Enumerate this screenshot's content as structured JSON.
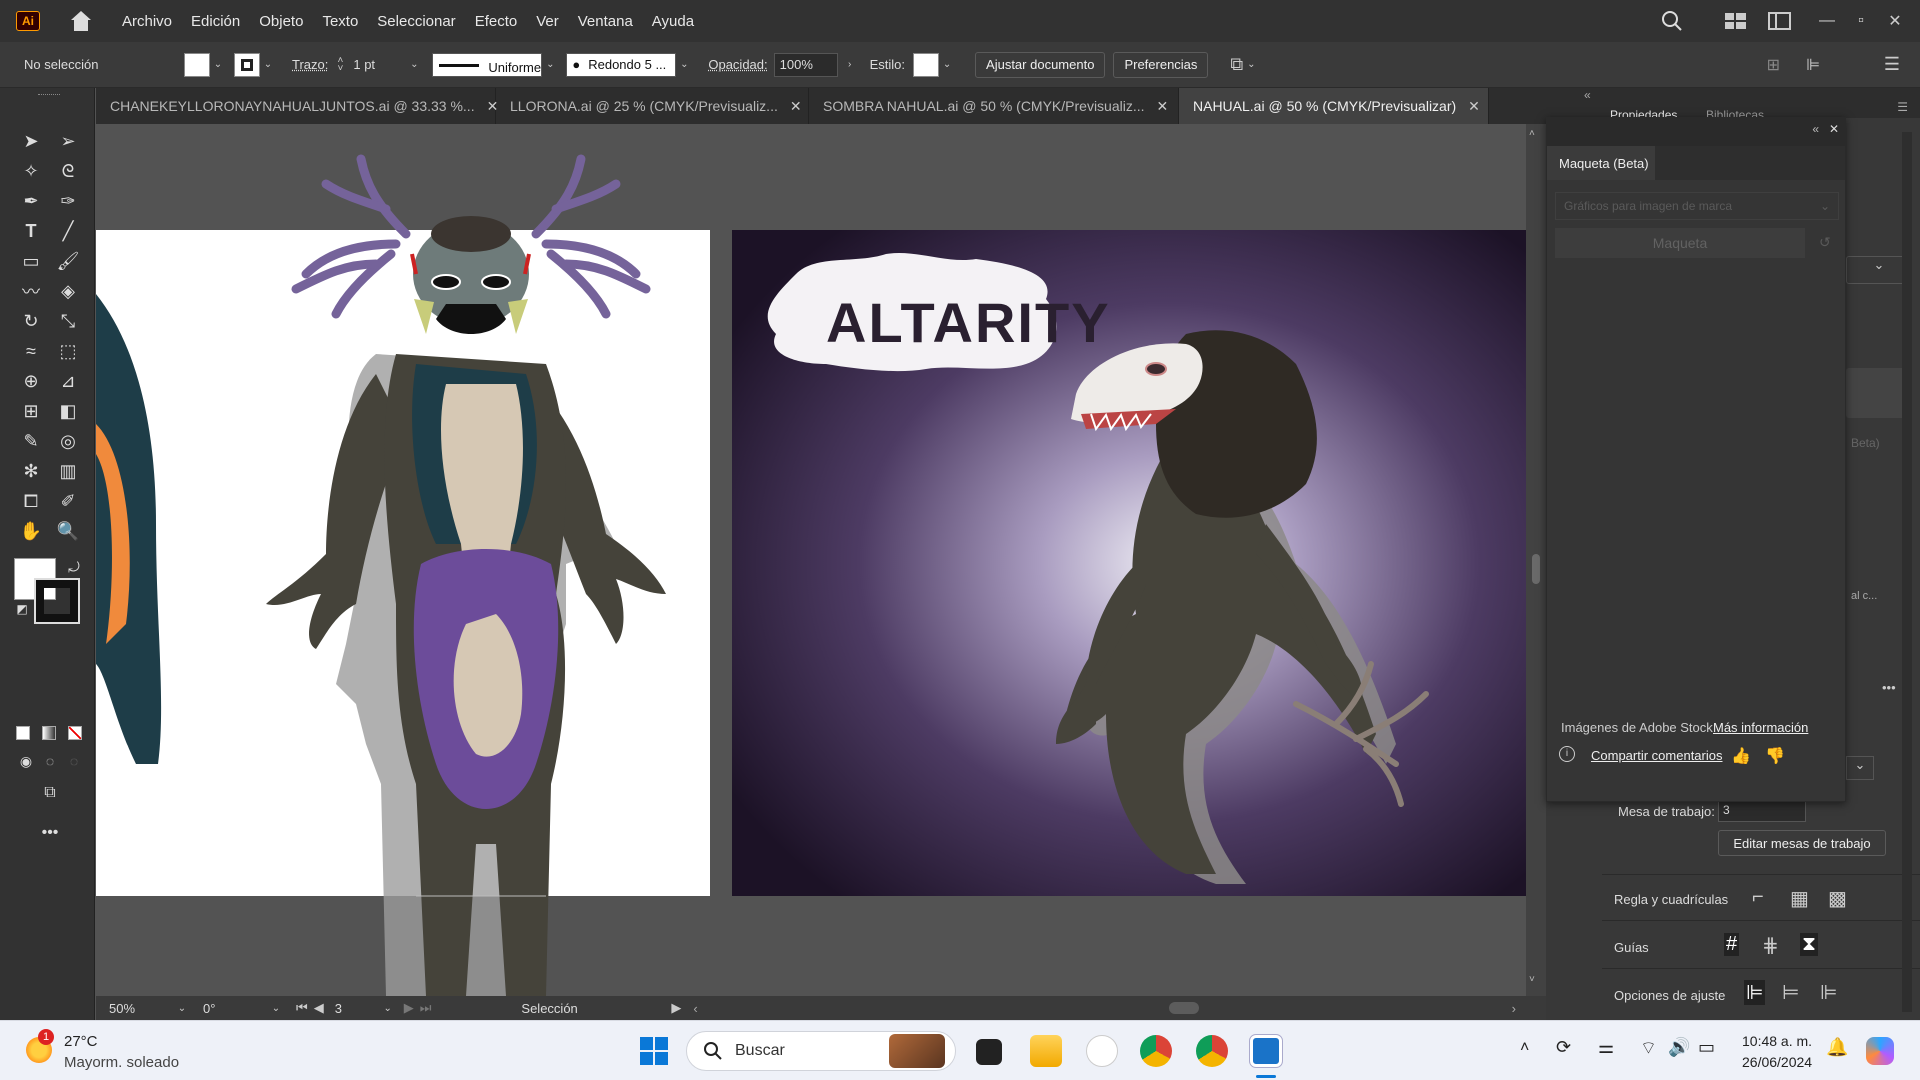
{
  "app": {
    "logo": "Ai"
  },
  "menu": [
    "Archivo",
    "Edición",
    "Objeto",
    "Texto",
    "Seleccionar",
    "Efecto",
    "Ver",
    "Ventana",
    "Ayuda"
  ],
  "controlbar": {
    "selection": "No selección",
    "stroke_label": "Trazo:",
    "stroke_value": "1 pt",
    "profile": "Uniforme",
    "brush": "Redondo 5 ...",
    "opacity_label": "Opacidad:",
    "opacity_value": "100%",
    "style_label": "Estilo:",
    "fit_button": "Ajustar documento",
    "prefs_button": "Preferencias"
  },
  "tabs": [
    {
      "label": "CHANEKEYLLORONAYNAHUALJUNTOS.ai @ 33.33 %...",
      "active": false
    },
    {
      "label": "LLORONA.ai @ 25 % (CMYK/Previsualiz...",
      "active": false
    },
    {
      "label": "SOMBRA NAHUAL.ai @ 50 % (CMYK/Previsualiz...",
      "active": false
    },
    {
      "label": "NAHUAL.ai @ 50 % (CMYK/Previsualizar)",
      "active": true
    }
  ],
  "artwork": {
    "title": "ALTARITY"
  },
  "statusbar": {
    "zoom": "50%",
    "rotation": "0°",
    "artboard": "3",
    "tool": "Selección"
  },
  "maqueta_panel": {
    "title": "Maqueta (Beta)",
    "dropdown_placeholder": "Gráficos para imagen de marca",
    "button": "Maqueta",
    "stock_text": "Imágenes de Adobe Stock",
    "more_info": "Más información",
    "feedback": "Compartir comentarios"
  },
  "properties_panel": {
    "tab1": "Propiedades",
    "tab2": "Bibliotecas",
    "artboard_label": "Mesa de trabajo:",
    "artboard_value": "3",
    "edit_artboards": "Editar mesas de trabajo",
    "rulers": "Regla y cuadrículas",
    "guides": "Guías",
    "snap": "Opciones de ajuste",
    "partial1": "Beta)",
    "partial2": "al c..."
  },
  "taskbar": {
    "weather_temp": "27°C",
    "weather_desc": "Mayorm. soleado",
    "weather_badge": "1",
    "search": "Buscar",
    "time": "10:48 a. m.",
    "date": "26/06/2024"
  },
  "colors": {
    "accent": "#1473e6",
    "purple": "#6c4c9a",
    "dark_body": "#45433a",
    "teal": "#1e3d48",
    "bg_gradient_center": "#cfc8df",
    "bg_gradient_edge": "#1c1226"
  }
}
